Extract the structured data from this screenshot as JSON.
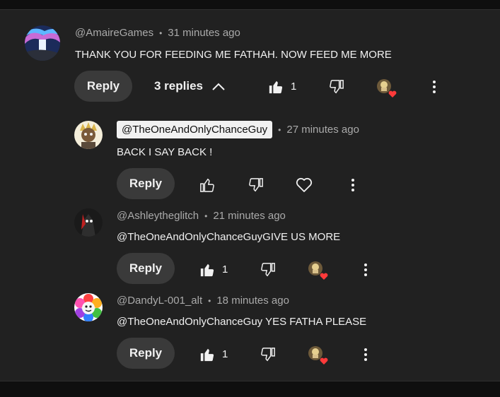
{
  "thread": {
    "comments": [
      {
        "author": "@AmaireGames",
        "time": "31 minutes ago",
        "text": "THANK YOU FOR FEEDING ME FATHAH. NOW FEED ME MORE",
        "reply_label": "Reply",
        "replies_label": "3 replies",
        "likes": "1"
      },
      {
        "author": "@TheOneAndOnlyChanceGuy",
        "time": "27 minutes ago",
        "text": "BACK I SAY BACK !",
        "reply_label": "Reply"
      },
      {
        "author": "@Ashleytheglitch",
        "time": "21 minutes ago",
        "text": "@TheOneAndOnlyChanceGuyGIVE US MORE",
        "reply_label": "Reply",
        "likes": "1"
      },
      {
        "author": "@DandyL-001_alt",
        "time": "18 minutes ago",
        "text": "@TheOneAndOnlyChanceGuy YES FATHA PLEASE",
        "reply_label": "Reply",
        "likes": "1"
      }
    ],
    "separator": "•"
  },
  "colors": {
    "background": "#212121",
    "text": "#f1f1f1",
    "muted": "#aaaaaa",
    "button": "#3a3a3a",
    "heart": "#ff3a3a"
  },
  "icons": [
    "thumbs-up-icon",
    "thumbs-down-icon",
    "heart-outline-icon",
    "more-vert-icon",
    "chevron-up-icon",
    "creator-heart-icon"
  ]
}
